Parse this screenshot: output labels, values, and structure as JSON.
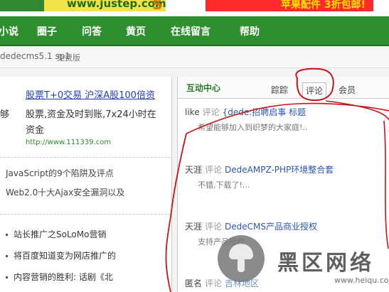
{
  "top": {
    "brand_url": "www.justep.com",
    "brand_s": "S",
    "ad_left": "",
    "ad_right": "苹果配件  3折包邮!"
  },
  "nav": {
    "items": [
      "小说",
      "圈子",
      "问答",
      "黄页",
      "在线留言",
      "帮助"
    ]
  },
  "version": {
    "text": "dedecms5.1 sp1",
    "free": "免费版"
  },
  "ad": {
    "title": "股票T+0交易 沪深A股100倍资",
    "left_fragment": "够",
    "body1": "股票,资金及时到账,7x24小时在",
    "body2": "资金",
    "url": "http://www.111339.com"
  },
  "links": [
    "JavaScript的9个陷阱及评点",
    "Web2.0十大Ajax安全漏洞以及"
  ],
  "bullets": [
    "站长推广之SoLoMo营销",
    "将百度知道变为网店推广的",
    "内容营销的胜利: 话剧《北"
  ],
  "panel": {
    "title": "互动中心",
    "tabs": [
      "踪踪",
      "评论",
      "会员"
    ],
    "entries": [
      {
        "user": "like",
        "action": "评论",
        "link": "{dede:招聘启事 标题",
        "comment": "希望能够加入到织梦的大家庭!.."
      },
      {
        "user": "天涯",
        "action": "评论",
        "link": "DedeAMPZ-PHP环境整合套",
        "comment": "不错,下载了!..."
      },
      {
        "user": "天涯",
        "action": "评论",
        "link": "DedeCMS产品商业授权",
        "comment": "支持产品授权"
      },
      {
        "user": "匿名",
        "action": "评论",
        "link": "吉林地区",
        "comment": ""
      }
    ]
  },
  "watermark": {
    "text": "黑区网络",
    "url": "www.heiqu.com"
  },
  "colors": {
    "nav_green": "#2f8f2f",
    "annotation_red": "#c41616",
    "link_blue": "#2b55b8"
  }
}
